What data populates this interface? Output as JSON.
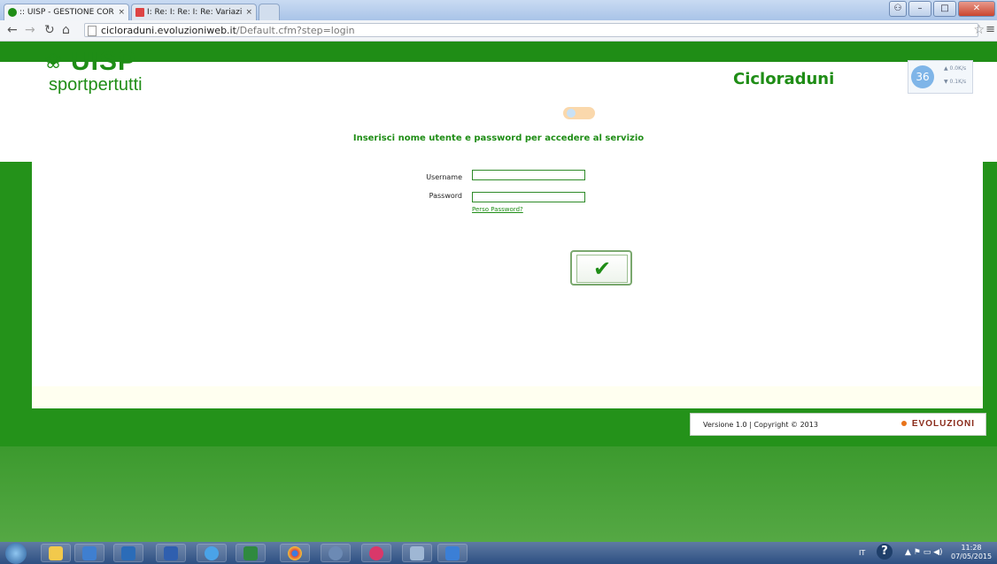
{
  "browser": {
    "tabs": [
      {
        "title": ":: UISP - GESTIONE CORSI",
        "active": true
      },
      {
        "title": "I: Re: I: Re: I: Re: Variazione",
        "active": false
      },
      {
        "title": "",
        "active": false
      }
    ],
    "close_glyph": "×",
    "url_host": "cicloraduni.evoluzioniweb.it",
    "url_path": "/Default.cfm?step=login"
  },
  "site": {
    "logo_main": "UISP",
    "logo_sub": "sportpertutti",
    "title": "Cicloraduni"
  },
  "net_widget": {
    "value": "36",
    "up": "0.0K/s",
    "down": "0.1K/s"
  },
  "login": {
    "prompt": "Inserisci nome utente e password per accedere al servizio",
    "username_label": "Username",
    "password_label": "Password",
    "username_value": "",
    "password_value": "",
    "forgot_link": "Perso Password?",
    "submit_icon": "checkmark-icon"
  },
  "footer": {
    "version_text": "Versione 1.0 | Copyright © 2013",
    "brand": "EVOLUZIONI"
  },
  "taskbar": {
    "apps": [
      "explorer-icon",
      "media-player-icon",
      "outlook-icon",
      "word-icon",
      "internet-explorer-icon",
      "excel-icon",
      "chrome-icon",
      "itunes-helper-icon",
      "itunes-icon",
      "photo-icon",
      "music-icon"
    ],
    "language": "IT",
    "time": "11:28",
    "date": "07/05/2015"
  },
  "colors": {
    "brand_green": "#1f8d16",
    "page_bg": "#2a8a22"
  }
}
